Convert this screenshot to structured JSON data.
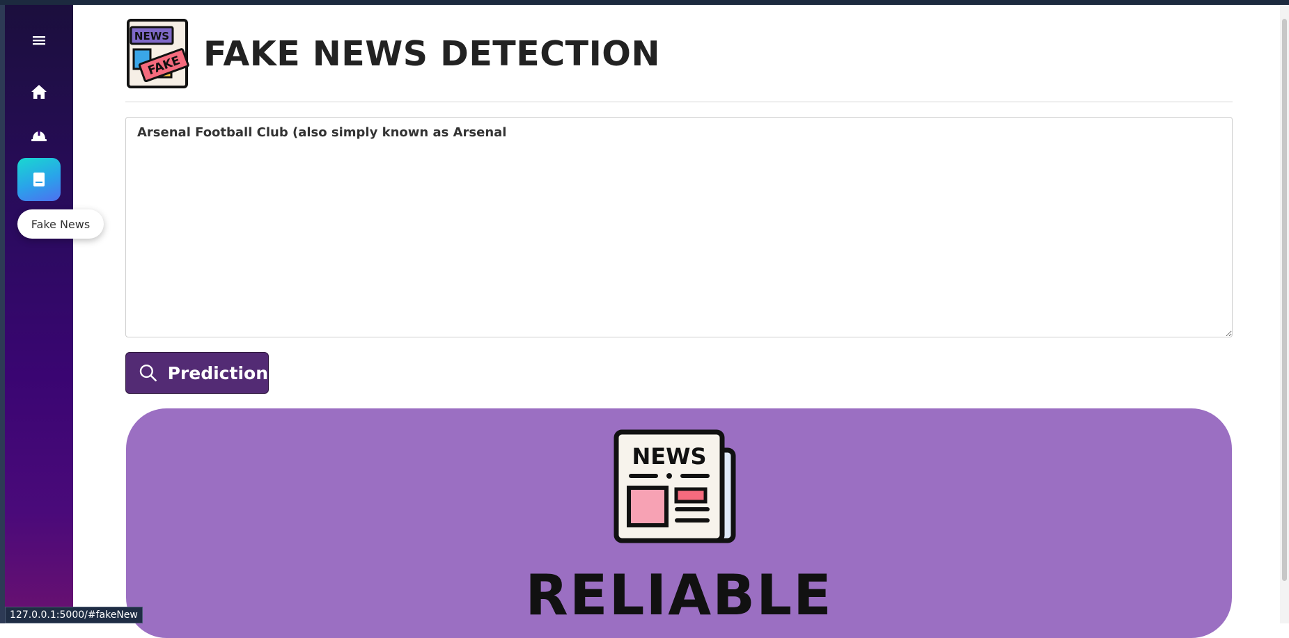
{
  "header": {
    "title": "FAKE NEWS DETECTION"
  },
  "sidebar": {
    "items": [
      {
        "icon": "menu-icon"
      },
      {
        "icon": "home-icon"
      },
      {
        "icon": "hard-hat-icon"
      },
      {
        "icon": "book-icon",
        "active": true
      }
    ],
    "tooltip": "Fake News"
  },
  "input": {
    "value": "Arsenal Football Club (also simply known as Arsenal"
  },
  "predict_button": {
    "label": "Prediction",
    "icon": "search-icon"
  },
  "result": {
    "label": "RELIABLE",
    "icon": "newspaper-icon"
  },
  "status_bar": {
    "url": "127.0.0.1:5000/#fakeNew"
  },
  "colors": {
    "button": "#532b74",
    "result_panel": "#9b6fc2",
    "sidebar_top": "#1b0f3d",
    "sidebar_bottom": "#6b1170",
    "active_tab": "#2aa2ea"
  }
}
